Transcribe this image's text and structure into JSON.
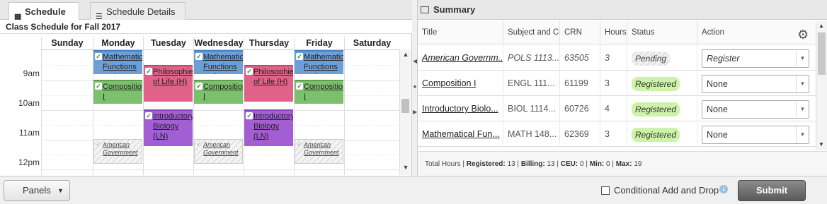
{
  "schedule": {
    "tabs": [
      {
        "label": "Schedule",
        "icon": "calendar-icon"
      },
      {
        "label": "Schedule Details",
        "icon": "list-icon"
      }
    ],
    "caption": "Class Schedule for Fall 2017",
    "days": [
      "Sunday",
      "Monday",
      "Tuesday",
      "Wednesday",
      "Thursday",
      "Friday",
      "Saturday"
    ],
    "times": [
      "9am",
      "10am",
      "11am",
      "12pm"
    ],
    "events": {
      "math": "Mathematical Functions and",
      "phil": "Philosophies of Life (H)",
      "comp": "Composition I",
      "bio": "Introductory Biology (LN)",
      "amgov": "American Government"
    }
  },
  "summary": {
    "title": "Summary",
    "columns": [
      "Title",
      "Subject and Course",
      "CRN",
      "Hours",
      "Status",
      "Action"
    ],
    "rows": [
      {
        "title": "American Governm...",
        "subject": "POLS 1113...",
        "crn": "63505",
        "hours": "3",
        "status": "Pending",
        "action": "Register"
      },
      {
        "title": "Composition I",
        "subject": "ENGL 111...",
        "crn": "61199",
        "hours": "3",
        "status": "Registered",
        "action": "None"
      },
      {
        "title": "Introductory Biolo...",
        "subject": "BIOL 1114...",
        "crn": "60726",
        "hours": "4",
        "status": "Registered",
        "action": "None"
      },
      {
        "title": "Mathematical Fun...",
        "subject": "MATH 148...",
        "crn": "62369",
        "hours": "3",
        "status": "Registered",
        "action": "None"
      }
    ],
    "totals": {
      "prefix": "Total Hours |",
      "registered_label": "Registered:",
      "registered": "13",
      "billing_label": "Billing:",
      "billing": "13",
      "ceu_label": "CEU:",
      "ceu": "0",
      "min_label": "Min:",
      "min": "0",
      "max_label": "Max:",
      "max": "19"
    }
  },
  "footer": {
    "panels_label": "Panels",
    "conditional_label": "Conditional Add and Drop",
    "submit_label": "Submit"
  },
  "colors": {
    "math": "#6c9fd6",
    "phil": "#e0628a",
    "comp": "#7cc06e",
    "bio": "#a35ed4",
    "registered": "#cdf3a8"
  }
}
